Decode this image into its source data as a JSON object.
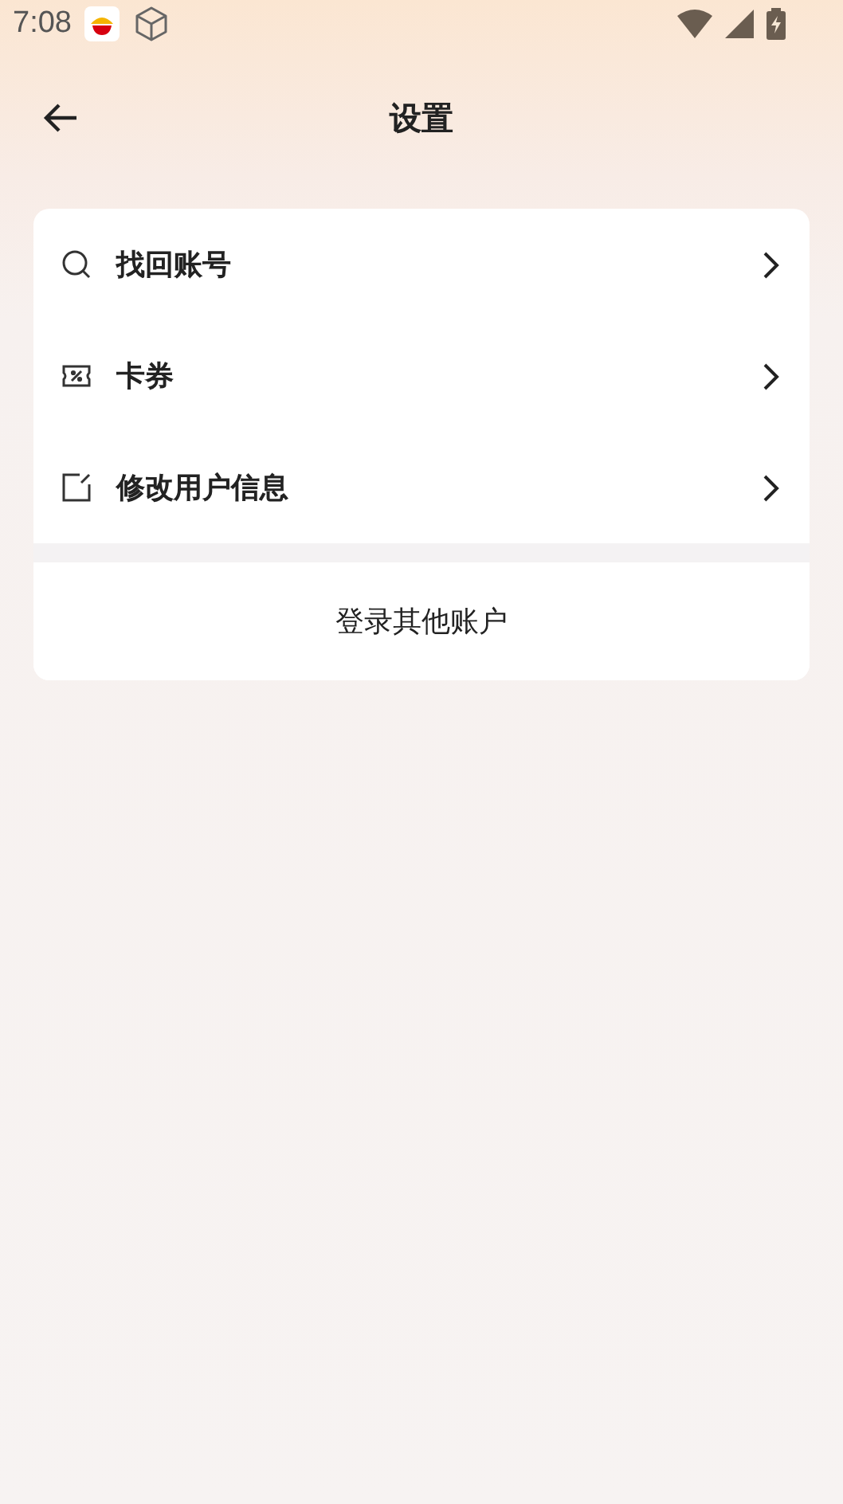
{
  "status_bar": {
    "time": "7:08"
  },
  "header": {
    "title": "设置"
  },
  "menu_items": [
    {
      "kind": "search",
      "label": "找回账号"
    },
    {
      "kind": "coupon",
      "label": "卡券"
    },
    {
      "kind": "edit",
      "label": "修改用户信息"
    }
  ],
  "login_button": {
    "label": "登录其他账户"
  }
}
